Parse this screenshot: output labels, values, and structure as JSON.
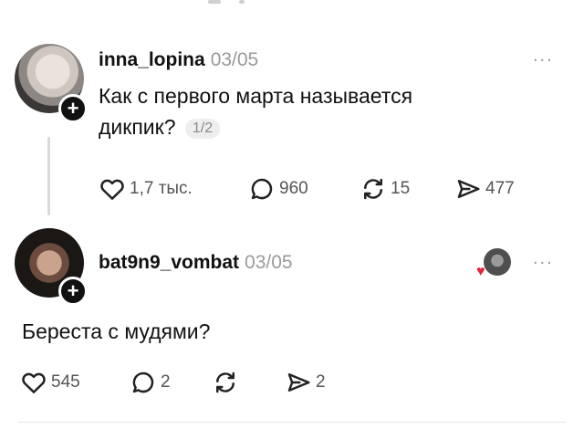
{
  "posts": [
    {
      "username": "inna_lopina",
      "date": "03/05",
      "text_line1": "Как  с первого марта называется",
      "text_line2": "дикпик?",
      "page_indicator": "1/2",
      "more_label": "...",
      "actions": {
        "likes": "1,7 тыс.",
        "comments": "960",
        "reposts": "15",
        "shares": "477"
      },
      "icons": {
        "like": "heart-icon",
        "comment": "comment-bubble-icon",
        "repost": "repost-icon",
        "share": "share-icon"
      }
    },
    {
      "username": "bat9n9_vombat",
      "date": "03/05",
      "text": "Береста с мудями?",
      "more_label": "...",
      "actions": {
        "likes": "545",
        "comments": "2",
        "reposts": "",
        "shares": "2"
      },
      "liked_by_author": true,
      "heart_color": "#e2243a"
    }
  ]
}
